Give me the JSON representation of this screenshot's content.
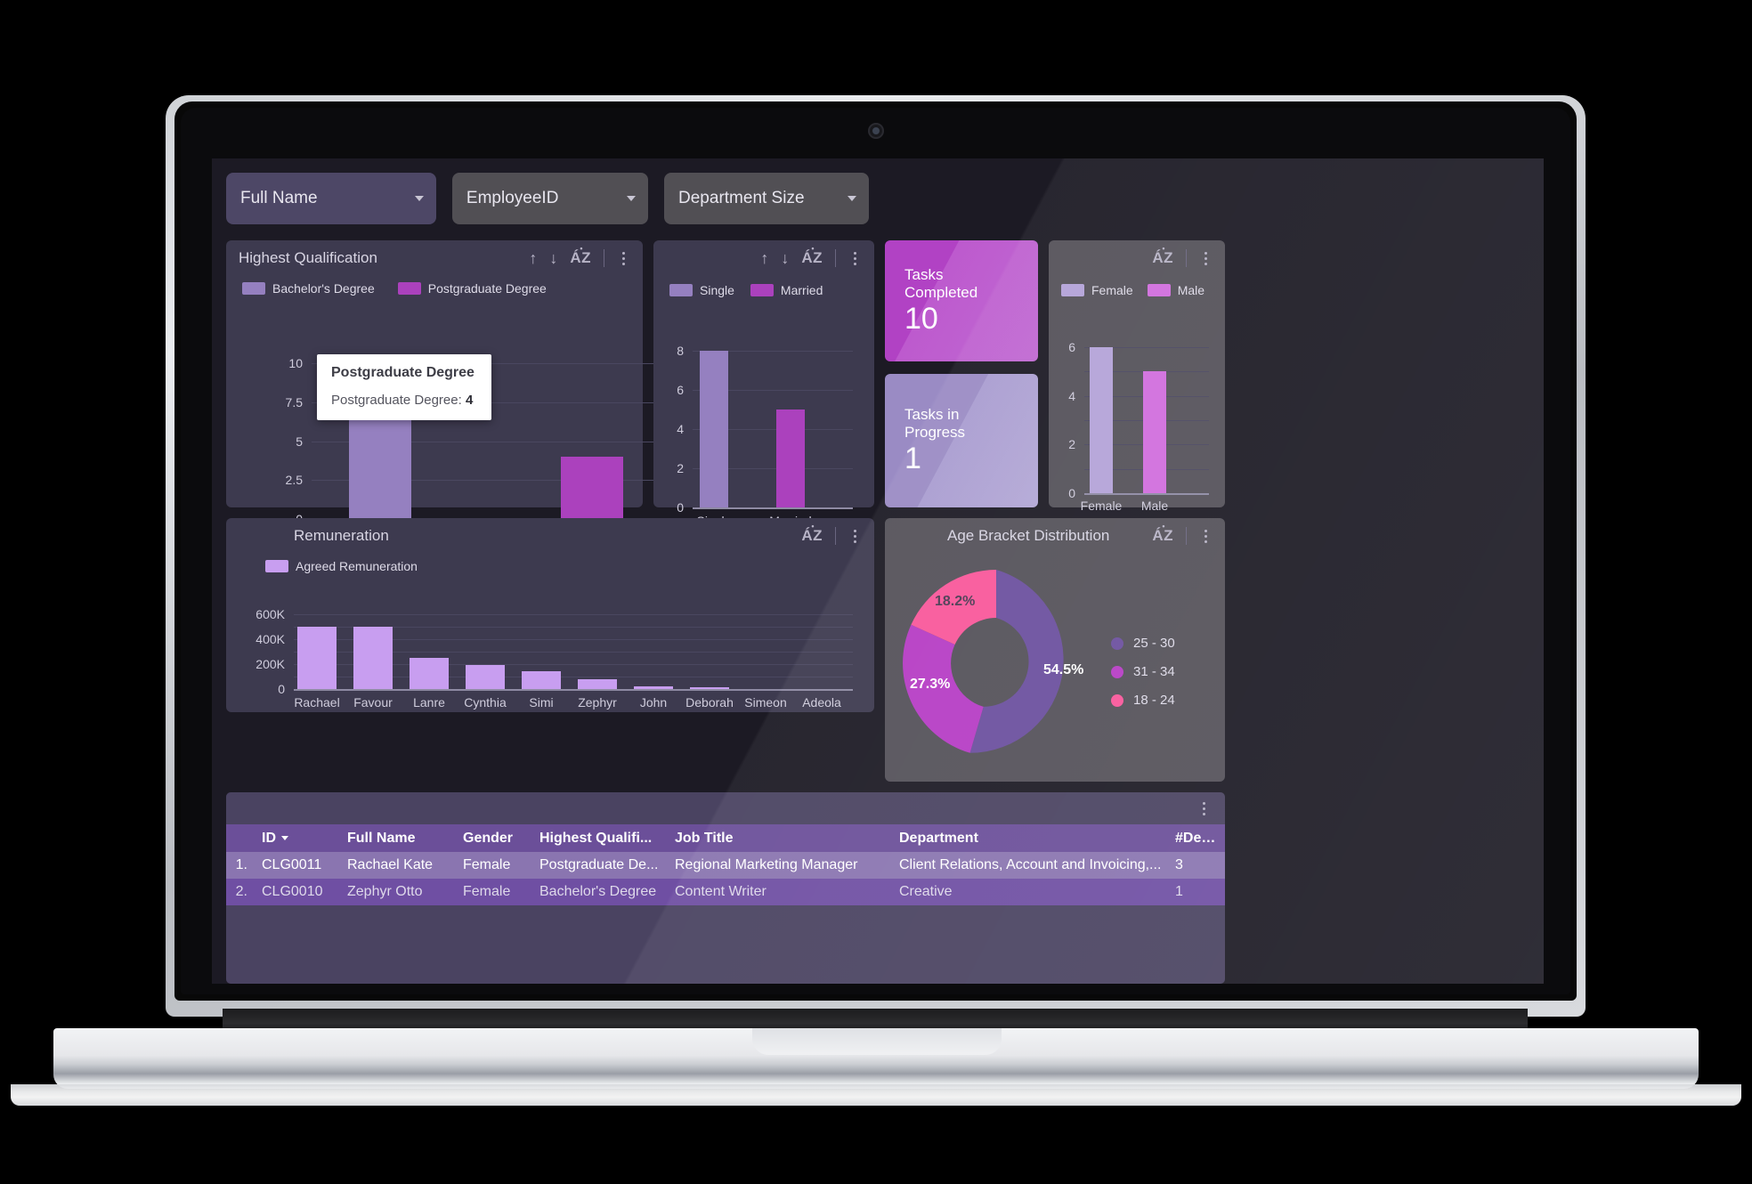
{
  "filters": [
    {
      "label": "Full Name",
      "active": true
    },
    {
      "label": "EmployeeID",
      "active": false
    },
    {
      "label": "Department Size",
      "active": false
    }
  ],
  "panels": {
    "qualification": {
      "title": "Highest Qualification",
      "tools": {
        "sort_asc": "sort-ascending-icon",
        "sort_desc": "sort-descending-icon",
        "alpha": "AZ",
        "more": "more-options-icon"
      }
    },
    "marital": {
      "title": ""
    },
    "remuneration": {
      "title": "Remuneration"
    },
    "gender": {
      "title": ""
    },
    "age": {
      "title": "Age Bracket Distribution"
    }
  },
  "tooltip": {
    "title": "Postgraduate Degree",
    "row_label": "Postgraduate Degree:",
    "row_value": "4"
  },
  "kpis": [
    {
      "label": "Tasks Completed",
      "value": "10",
      "color": "#b142c4"
    },
    {
      "label": "Tasks in Progress",
      "value": "1",
      "color": "#9a8bc4"
    }
  ],
  "colors": {
    "lilac": "#9580c0",
    "magenta": "#ab41bd",
    "light_lilac": "#c89ef0",
    "panel": "#3d3a4f",
    "panel_gray": "#545159",
    "screen_bg": "#1c1a24",
    "donut_1": "#6b4f9e",
    "donut_2": "#b63cc4",
    "donut_3": "#f9579a"
  },
  "chart_data": [
    {
      "type": "bar",
      "title": "Highest Qualification",
      "categories": [
        "Bachelor's Degree",
        "Postgraduate Degree"
      ],
      "values": [
        9,
        4
      ],
      "legend": [
        "Bachelor's Degree",
        "Postgraduate Degree"
      ],
      "legend_position": "top-left",
      "yticks": [
        "0",
        "2.5",
        "5",
        "7.5",
        "10"
      ],
      "ylim": [
        0,
        10
      ],
      "xlabel": "",
      "ylabel": "",
      "grid": true,
      "series_colors": [
        "#9580c0",
        "#ab41bd"
      ]
    },
    {
      "type": "bar",
      "title": "",
      "categories": [
        "Single",
        "Married"
      ],
      "values": [
        8,
        5
      ],
      "legend": [
        "Single",
        "Married"
      ],
      "legend_position": "top-left",
      "yticks": [
        "0",
        "2",
        "4",
        "6",
        "8"
      ],
      "ylim": [
        0,
        8
      ],
      "xlabel": "",
      "ylabel": "",
      "grid": true,
      "series_colors": [
        "#9580c0",
        "#ab41bd"
      ]
    },
    {
      "type": "bar",
      "title": "",
      "categories": [
        "Female",
        "Male"
      ],
      "values": [
        6,
        5
      ],
      "legend": [
        "Female",
        "Male"
      ],
      "legend_position": "top-left",
      "yticks": [
        "0",
        "2",
        "4",
        "6"
      ],
      "ylim": [
        0,
        6
      ],
      "xlabel": "",
      "ylabel": "",
      "grid": true,
      "series_colors": [
        "#b3a2d8",
        "#d06ddd"
      ]
    },
    {
      "type": "bar",
      "title": "Remuneration",
      "categories": [
        "Rachael",
        "Favour",
        "Lanre",
        "Cynthia",
        "Simi",
        "Zephyr",
        "John",
        "Deborah",
        "Simeon",
        "Adeola"
      ],
      "values": [
        500000,
        500000,
        250000,
        195000,
        145000,
        80000,
        25000,
        15000,
        0,
        0
      ],
      "legend": [
        "Agreed Remuneration"
      ],
      "legend_position": "top-left",
      "yticks": [
        "0",
        "200K",
        "400K",
        "600K"
      ],
      "ylim": [
        0,
        600000
      ],
      "xlabel": "",
      "ylabel": "",
      "grid": true,
      "series_colors": [
        "#c89ef0"
      ]
    },
    {
      "type": "pie",
      "title": "Age Bracket Distribution",
      "labels": [
        "25 - 30",
        "31 - 34",
        "18 - 24"
      ],
      "values": [
        54.5,
        27.3,
        18.2
      ],
      "value_labels": [
        "54.5%",
        "27.3%",
        "18.2%"
      ],
      "colors": [
        "#6b4f9e",
        "#b63cc4",
        "#f9579a"
      ],
      "legend_position": "right",
      "donut": true
    }
  ],
  "table": {
    "columns": [
      "ID",
      "Full Name",
      "Gender",
      "Highest Qualifi...",
      "Job Title",
      "Department",
      "#Dept(s)"
    ],
    "sorted_column": "ID",
    "rows": [
      {
        "index": "1.",
        "id": "CLG0011",
        "name": "Rachael Kate",
        "gender": "Female",
        "qualification": "Postgraduate De...",
        "job_title": "Regional Marketing Manager",
        "department": "Client Relations, Account and Invoicing,...",
        "dept_count": "3"
      },
      {
        "index": "2.",
        "id": "CLG0010",
        "name": "Zephyr Otto",
        "gender": "Female",
        "qualification": "Bachelor's Degree",
        "job_title": "Content Writer",
        "department": "Creative",
        "dept_count": "1"
      }
    ]
  }
}
